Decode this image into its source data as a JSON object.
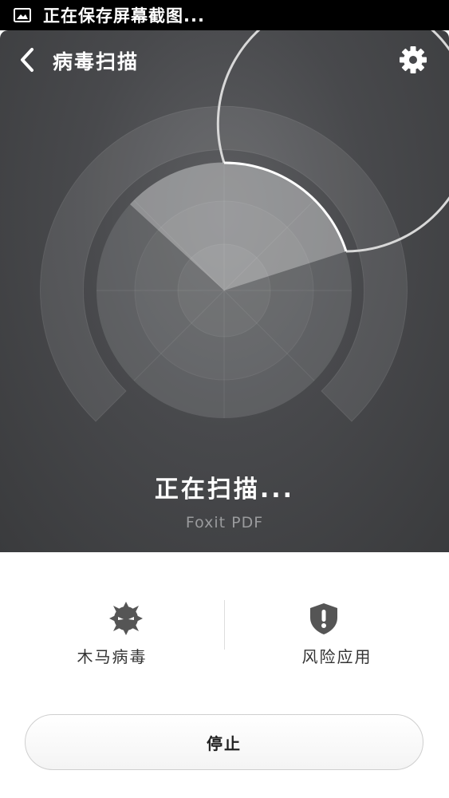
{
  "status_bar": {
    "icon": "image-icon",
    "text": "正在保存屏幕截图..."
  },
  "header": {
    "back_icon": "chevron-left-icon",
    "title": "病毒扫描",
    "settings_icon": "gear-icon"
  },
  "scan": {
    "status": "正在扫描...",
    "subtitle": "Foxit PDF"
  },
  "categories": [
    {
      "icon": "virus-bug-icon",
      "label": "木马病毒"
    },
    {
      "icon": "shield-alert-icon",
      "label": "风险应用"
    }
  ],
  "stop_button": {
    "label": "停止"
  },
  "colors": {
    "panel_dark": "#3a3b3d",
    "panel_light": "#5d5e61",
    "icon_gray": "#555555"
  }
}
